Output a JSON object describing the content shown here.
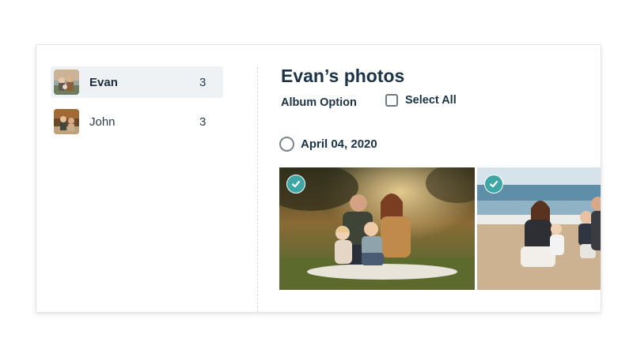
{
  "people": [
    {
      "name": "Evan",
      "count": "3",
      "selected": true
    },
    {
      "name": "John",
      "count": "3",
      "selected": false
    }
  ],
  "main": {
    "title": "Evan’s photos",
    "album_option_label": "Album Option",
    "select_all_label": "Select All",
    "date_group": {
      "date": "April 04, 2020",
      "photos": [
        {
          "selected": true,
          "scene": "family portrait in park"
        },
        {
          "selected": true,
          "scene": "family on beach"
        }
      ]
    }
  },
  "colors": {
    "accent": "#3ea7a5",
    "text": "#1b3346",
    "selected_row_bg": "#eef2f4"
  }
}
